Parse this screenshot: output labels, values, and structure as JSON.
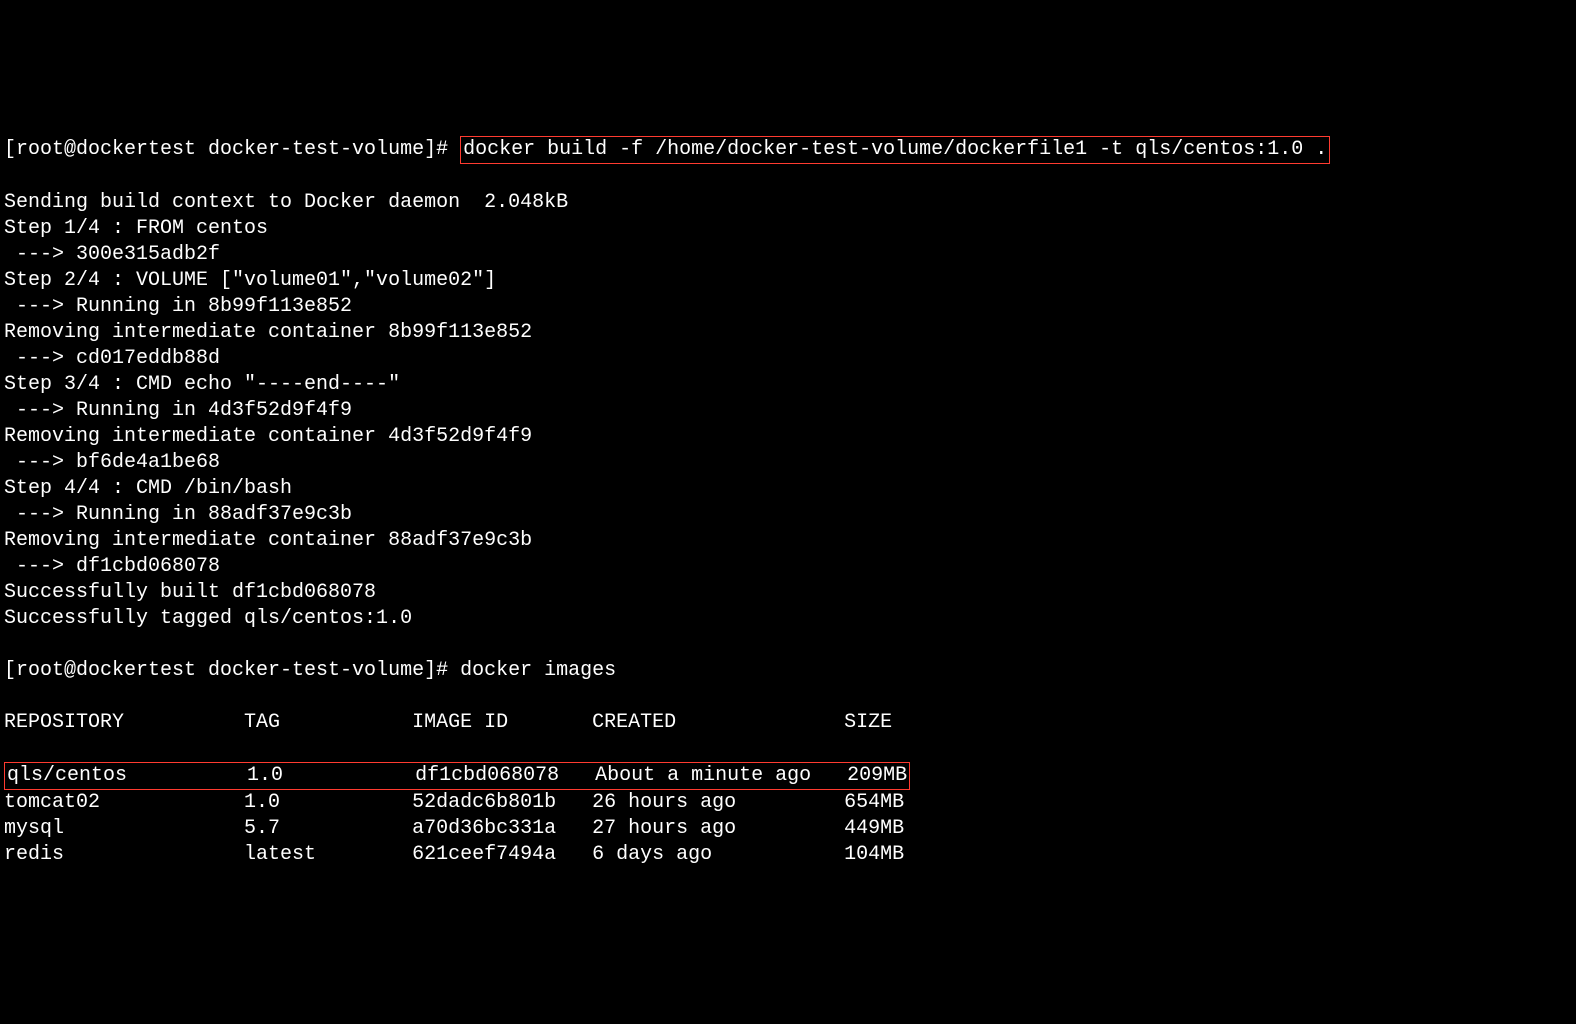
{
  "prompt1_prefix": "[root@dockertest docker-test-volume]# ",
  "build_command": "docker build -f /home/docker-test-volume/dockerfile1 -t qls/centos:1.0 .",
  "build_output": [
    "Sending build context to Docker daemon  2.048kB",
    "Step 1/4 : FROM centos",
    " ---> 300e315adb2f",
    "Step 2/4 : VOLUME [\"volume01\",\"volume02\"]",
    " ---> Running in 8b99f113e852",
    "Removing intermediate container 8b99f113e852",
    " ---> cd017eddb88d",
    "Step 3/4 : CMD echo \"----end----\"",
    " ---> Running in 4d3f52d9f4f9",
    "Removing intermediate container 4d3f52d9f4f9",
    " ---> bf6de4a1be68",
    "Step 4/4 : CMD /bin/bash",
    " ---> Running in 88adf37e9c3b",
    "Removing intermediate container 88adf37e9c3b",
    " ---> df1cbd068078",
    "Successfully built df1cbd068078",
    "Successfully tagged qls/centos:1.0"
  ],
  "prompt2_prefix": "[root@dockertest docker-test-volume]# ",
  "images_command": "docker images",
  "table_header": "REPOSITORY          TAG           IMAGE ID       CREATED              SIZE",
  "rows": [
    {
      "text": "qls/centos          1.0           df1cbd068078   About a minute ago   209MB",
      "highlighted": true
    },
    {
      "text": "tomcat02            1.0           52dadc6b801b   26 hours ago         654MB",
      "highlighted": false
    },
    {
      "text": "mysql               5.7           a70d36bc331a   27 hours ago         449MB",
      "highlighted": false
    },
    {
      "text": "redis               latest        621ceef7494a   6 days ago           104MB",
      "highlighted": false
    }
  ]
}
